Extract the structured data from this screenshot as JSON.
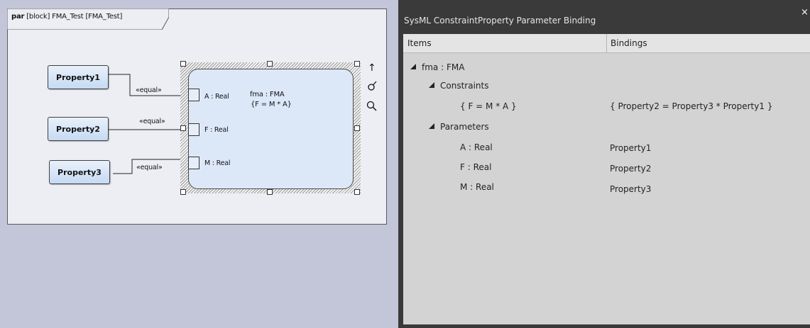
{
  "diagram": {
    "frame_kind": "par",
    "frame_rest": "[block] FMA_Test [FMA_Test]",
    "properties": [
      "Property1",
      "Property2",
      "Property3"
    ],
    "connector_label": "«equal»",
    "constraint_name": "fma : FMA",
    "constraint_expr": "{F = M * A}",
    "ports": [
      "A : Real",
      "F : Real",
      "M : Real"
    ],
    "tools": {
      "up": "↑",
      "brush": "ổ",
      "zoom": "🔍"
    }
  },
  "panel": {
    "title": "SysML ConstraintProperty Parameter Binding",
    "close": "×",
    "columns": [
      "Items",
      "Bindings"
    ],
    "root": "fma : FMA",
    "constraints_label": "Constraints",
    "constraint_item": "{ F = M * A }",
    "constraint_binding": "{ Property2 = Property3 * Property1 }",
    "parameters_label": "Parameters",
    "parameters": [
      {
        "name": "A : Real",
        "binding": "Property1"
      },
      {
        "name": "F : Real",
        "binding": "Property2"
      },
      {
        "name": "M : Real",
        "binding": "Property3"
      }
    ]
  },
  "colors": {
    "block_fill": "#dce8f8",
    "property_fill": "#c6daf3",
    "canvas": "#c3c6d9",
    "panel_bg": "#d3d3d3"
  }
}
